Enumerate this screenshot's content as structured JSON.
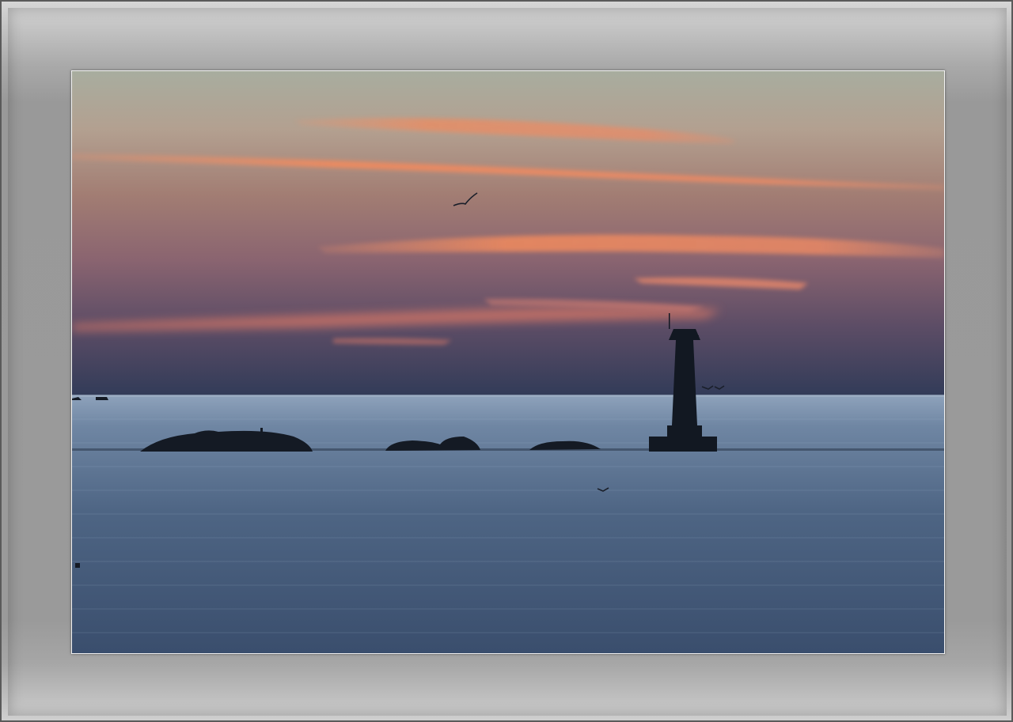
{
  "scene": {
    "subject": "lighthouse-at-sunset",
    "colors": {
      "sky_top": "#a3a99c",
      "sky_mid": "#b48a7a",
      "sky_low": "#7a5f72",
      "horizon": "#3a4360",
      "cloud_glow": "#f0875c",
      "sea_light": "#6f86a3",
      "sea_dark": "#2d3f5c",
      "silhouette": "#141a24",
      "frame": "#999999"
    }
  }
}
